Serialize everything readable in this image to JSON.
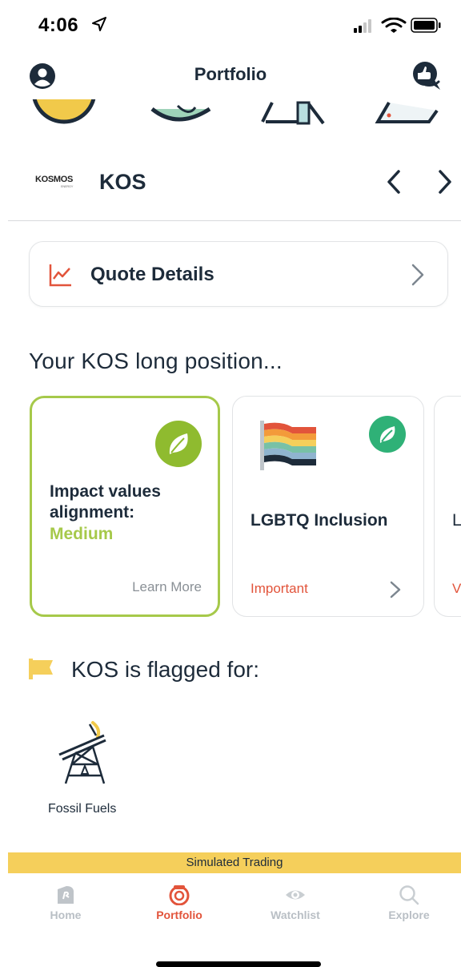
{
  "status_bar": {
    "time": "4:06"
  },
  "header": {
    "title": "Portfolio"
  },
  "stock": {
    "ticker": "KOS",
    "logo_text": "KOSMOS",
    "logo_sub": "ENERGY"
  },
  "quote": {
    "label": "Quote Details"
  },
  "position": {
    "title": "Your KOS long position...",
    "cards": [
      {
        "title": "Impact values alignment:",
        "level": "Medium",
        "action": "Learn More"
      },
      {
        "title": "LGBTQ Inclusion",
        "status": "Important"
      },
      {
        "title": "L",
        "status": "V"
      }
    ]
  },
  "flagged": {
    "title": "KOS is flagged for:",
    "items": [
      {
        "label": "Fossil Fuels"
      }
    ]
  },
  "banner": {
    "text": "Simulated Trading"
  },
  "tabs": [
    {
      "label": "Home",
      "icon": "home-icon",
      "active": false
    },
    {
      "label": "Portfolio",
      "icon": "portfolio-icon",
      "active": true
    },
    {
      "label": "Watchlist",
      "icon": "eye-icon",
      "active": false
    },
    {
      "label": "Explore",
      "icon": "search-icon",
      "active": false
    }
  ],
  "colors": {
    "accent": "#e2543b",
    "impact_green": "#a6c94a",
    "leaf_green": "#2fb177",
    "banner_yellow": "#f5cf5b",
    "text_dark": "#1d2b3a"
  }
}
